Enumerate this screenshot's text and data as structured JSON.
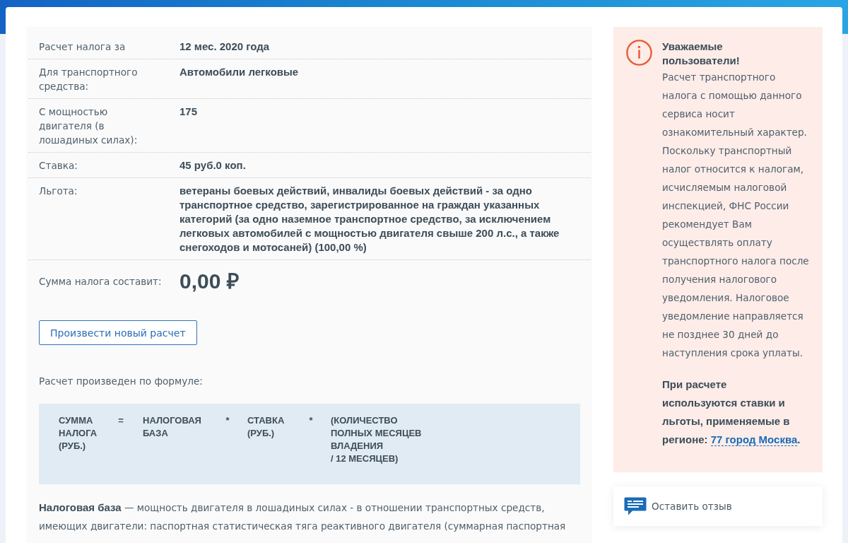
{
  "tax_details": {
    "rows": [
      {
        "label": "Расчет налога за",
        "value": "12 мес. 2020 года"
      },
      {
        "label": "Для транспортного средства:",
        "value": "Автомобили легковые"
      },
      {
        "label": "С мощностью двигателя (в лошадиных силах):",
        "value": "175"
      },
      {
        "label": "Ставка:",
        "value": "45 руб.0 коп."
      },
      {
        "label": "Льгота:",
        "value": "ветераны боевых действий, инвалиды боевых действий - за одно транспортное средство, зарегистрированное на граждан указанных категорий (за одно наземное транспортное средство, за исключением легковых автомобилей с мощностью двигателя свыше 200 л.с., а также снегоходов и мотосаней) (100,00 %)"
      }
    ]
  },
  "total": {
    "label": "Сумма налога составит:",
    "value": "0,00 ₽"
  },
  "recalculate_button": "Произвести новый расчет",
  "formula": {
    "caption": "Расчет произведен по формуле:",
    "parts": [
      {
        "kind": "term",
        "text": "СУММА НАЛОГА (РУБ.)"
      },
      {
        "kind": "operator",
        "text": "="
      },
      {
        "kind": "term",
        "text": "НАЛОГОВАЯ БАЗА"
      },
      {
        "kind": "operator",
        "text": "*"
      },
      {
        "kind": "term",
        "text": "СТАВКА (РУБ.)"
      },
      {
        "kind": "operator",
        "text": "*"
      },
      {
        "kind": "term",
        "text": "(КОЛИЧЕСТВО ПОЛНЫХ МЕСЯЦЕВ ВЛАДЕНИЯ\n/ 12 МЕСЯЦЕВ)"
      }
    ]
  },
  "explanation": "**Налоговая база** — мощность двигателя в лошадиных силах - в отношении транспортных средств, имеющих двигатели: паспортная статистическая тяга реактивного двигателя (суммарная паспортная",
  "notice": {
    "title": "Уважаемые пользователи!",
    "text": "Расчет транспортного налога с помощью данного сервиса носит ознакомительный характер. Поскольку транспортный налог относится к налогам, исчисляемым налоговой инспекцией, ФНС России рекомендует Вам осуществлять оплату транспортного налога после получения налогового уведомления. Налоговое уведомление направляется не позднее 30 дней до наступления срока уплаты.",
    "region_note": {
      "before": "При расчете используются ставки и льготы, применяемые в регионе:",
      "link": "77 город Москва",
      "after": "."
    }
  },
  "feedback_button": "Оставить отзыв"
}
